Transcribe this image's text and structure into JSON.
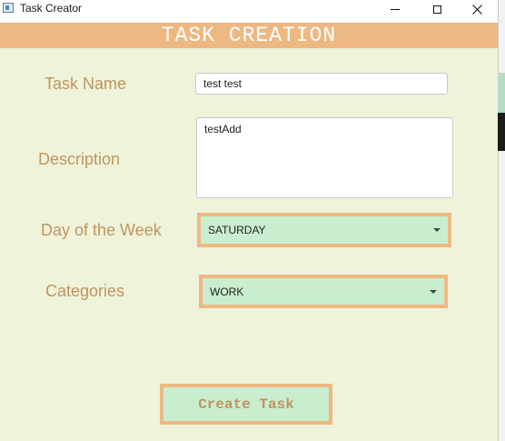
{
  "window": {
    "title": "Task Creator"
  },
  "header": {
    "title": "TASK CREATION"
  },
  "form": {
    "task_name": {
      "label": "Task Name",
      "value": "test test"
    },
    "description": {
      "label": "Description",
      "value": "testAdd"
    },
    "day_of_week": {
      "label": "Day of the Week",
      "selected": "SATURDAY"
    },
    "categories": {
      "label": "Categories",
      "selected": "WORK"
    },
    "submit_label": "Create Task"
  },
  "icons": {
    "app": "app-window-icon",
    "minimize": "minimize-icon",
    "maximize": "maximize-icon",
    "close": "close-icon",
    "dropdown": "chevron-down-icon"
  },
  "colors": {
    "background": "#eef3da",
    "accent": "#eeb882",
    "field_fill": "#c9eecf",
    "label_text": "#c09460",
    "header_text": "#ffffff"
  }
}
